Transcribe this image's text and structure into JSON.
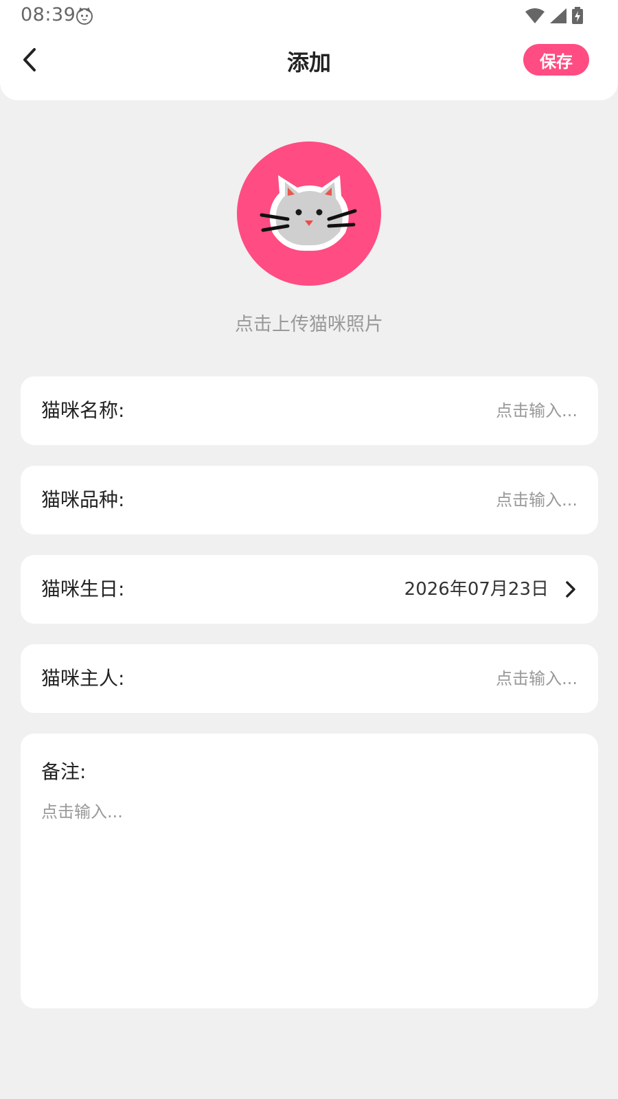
{
  "status_bar": {
    "time": "08:39"
  },
  "header": {
    "title": "添加",
    "save_label": "保存"
  },
  "avatar": {
    "upload_hint": "点击上传猫咪照片"
  },
  "fields": {
    "name": {
      "label": "猫咪名称:",
      "placeholder": "点击输入..."
    },
    "breed": {
      "label": "猫咪品种:",
      "placeholder": "点击输入..."
    },
    "birthday": {
      "label": "猫咪生日:",
      "value": "2026年07月23日"
    },
    "owner": {
      "label": "猫咪主人:",
      "placeholder": "点击输入..."
    }
  },
  "notes": {
    "label": "备注:",
    "placeholder": "点击输入..."
  },
  "colors": {
    "accent": "#ff4c82",
    "background": "#f0f0f0",
    "card": "#ffffff"
  }
}
